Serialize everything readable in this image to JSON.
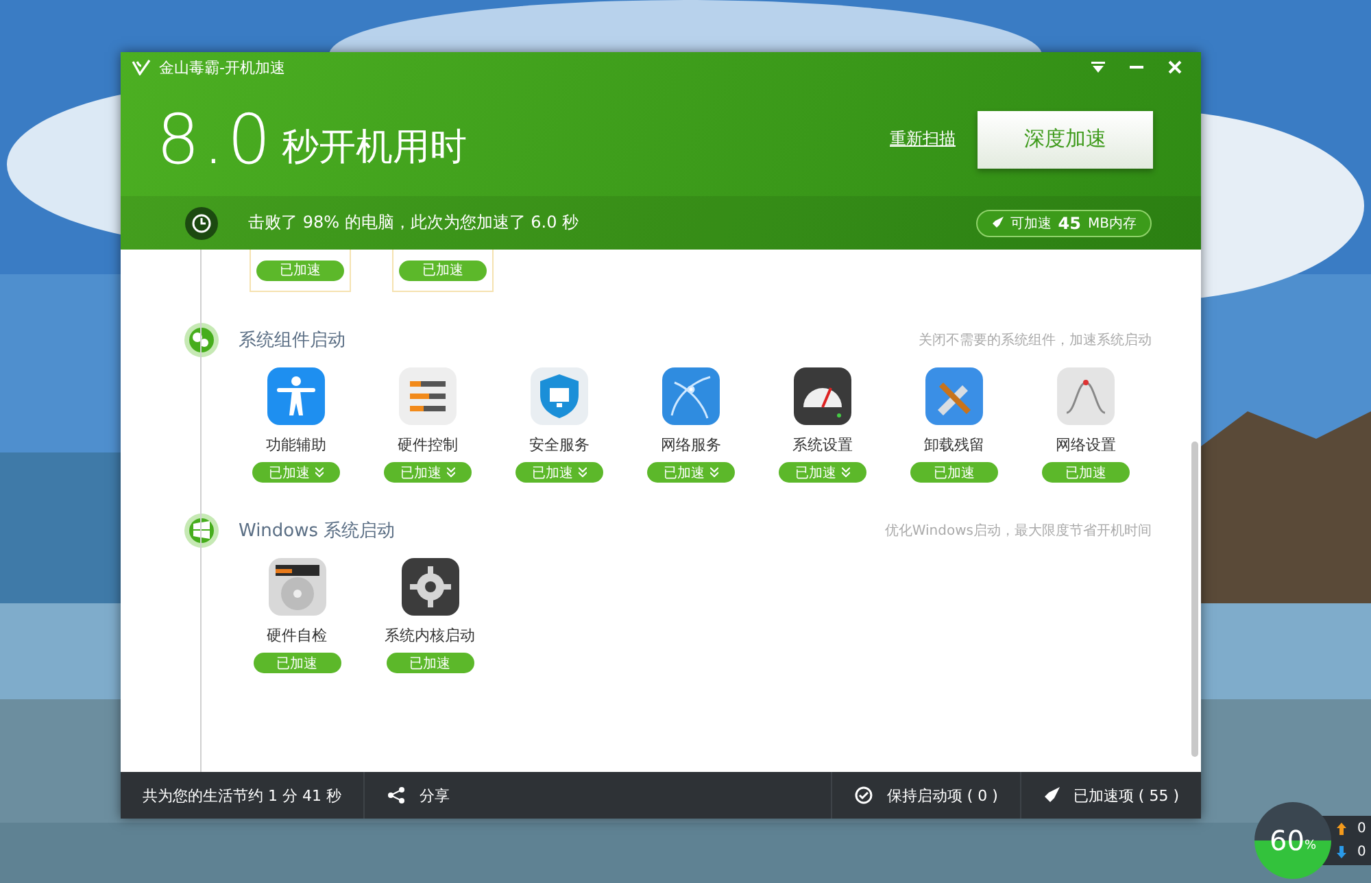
{
  "window": {
    "title": "金山毒霸-开机加速"
  },
  "header": {
    "boot_time": "8.0",
    "boot_label": "秒开机用时",
    "rescan_link": "重新扫描",
    "deep_button": "深度加速",
    "summary": "击败了 98% 的电脑，此次为您加速了 6.0 秒",
    "memory_badge": {
      "prefix": "可加速",
      "value": "45",
      "unit": "MB内存"
    }
  },
  "partial_items": [
    {
      "status": "已加速"
    },
    {
      "status": "已加速"
    }
  ],
  "sections": [
    {
      "kind": "components",
      "title": "系统组件启动",
      "hint": "关闭不需要的系统组件，加速系统启动",
      "items": [
        {
          "label": "功能辅助",
          "status": "已加速",
          "expandable": true
        },
        {
          "label": "硬件控制",
          "status": "已加速",
          "expandable": true
        },
        {
          "label": "安全服务",
          "status": "已加速",
          "expandable": true
        },
        {
          "label": "网络服务",
          "status": "已加速",
          "expandable": true
        },
        {
          "label": "系统设置",
          "status": "已加速",
          "expandable": true
        },
        {
          "label": "卸载残留",
          "status": "已加速",
          "expandable": false
        },
        {
          "label": "网络设置",
          "status": "已加速",
          "expandable": false
        }
      ]
    },
    {
      "kind": "windows",
      "title": "Windows 系统启动",
      "hint": "优化Windows启动，最大限度节省开机时间",
      "items": [
        {
          "label": "硬件自检",
          "status": "已加速",
          "expandable": false
        },
        {
          "label": "系统内核启动",
          "status": "已加速",
          "expandable": false
        }
      ]
    }
  ],
  "footer": {
    "saved": "共为您的生活节约 1 分 41 秒",
    "share": "分享",
    "keep": "保持启动项 ( 0 )",
    "accelerated": "已加速项 ( 55 )"
  },
  "widget": {
    "percent": "60",
    "unit": "%",
    "upload": "0",
    "download": "0"
  }
}
